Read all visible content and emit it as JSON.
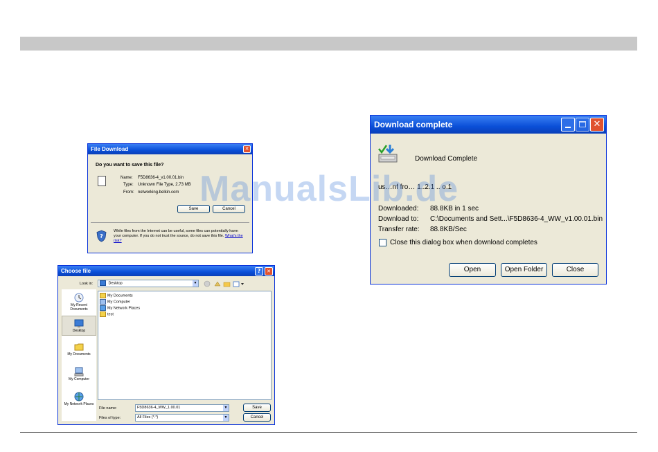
{
  "watermark": "ManualsLib.de",
  "file_download": {
    "title": "File Download",
    "question": "Do you want to save this file?",
    "name_label": "Name:",
    "name_value": "F5D8636-4_v1.00.01.bin",
    "type_label": "Type:",
    "type_value": "Unknown File Type, 2.73 MB",
    "from_label": "From:",
    "from_value": "networking.belkin.com",
    "save_label": "Save",
    "cancel_label": "Cancel",
    "warning_text": "While files from the Internet can be useful, some files can potentially harm your computer. If you do not trust the source, do not save this file.",
    "risk_link": "What's the risk?"
  },
  "choose_file": {
    "title": "Choose file",
    "help_glyph": "?",
    "close_glyph": "✕",
    "look_in_label": "Look in:",
    "look_in_value": "Desktop",
    "places": [
      {
        "label": "My Recent Documents"
      },
      {
        "label": "Desktop"
      },
      {
        "label": "My Documents"
      },
      {
        "label": "My Computer"
      },
      {
        "label": "My Network Places"
      }
    ],
    "items": [
      {
        "label": "My Documents"
      },
      {
        "label": "My Computer"
      },
      {
        "label": "My Network Places"
      },
      {
        "label": "test"
      }
    ],
    "file_name_label": "File name:",
    "file_name_value": "F5D8636-4_WW_1.00.01",
    "files_of_type_label": "Files of type:",
    "files_of_type_value": "All Files (*.*)",
    "save_label": "Save",
    "cancel_label": "Cancel"
  },
  "download_complete": {
    "title": "Download complete",
    "heading": "Download Complete",
    "saved_line": "us…nf fro… 1..2.1 .. o.1",
    "downloaded_label": "Downloaded:",
    "downloaded_value": "88.8KB in 1 sec",
    "download_to_label": "Download to:",
    "download_to_value": "C:\\Documents and Sett...\\F5D8636-4_WW_v1.00.01.bin",
    "transfer_rate_label": "Transfer rate:",
    "transfer_rate_value": "88.8KB/Sec",
    "close_checkbox_label": "Close this dialog box when download completes",
    "open_label": "Open",
    "open_folder_label": "Open Folder",
    "close_label": "Close"
  }
}
